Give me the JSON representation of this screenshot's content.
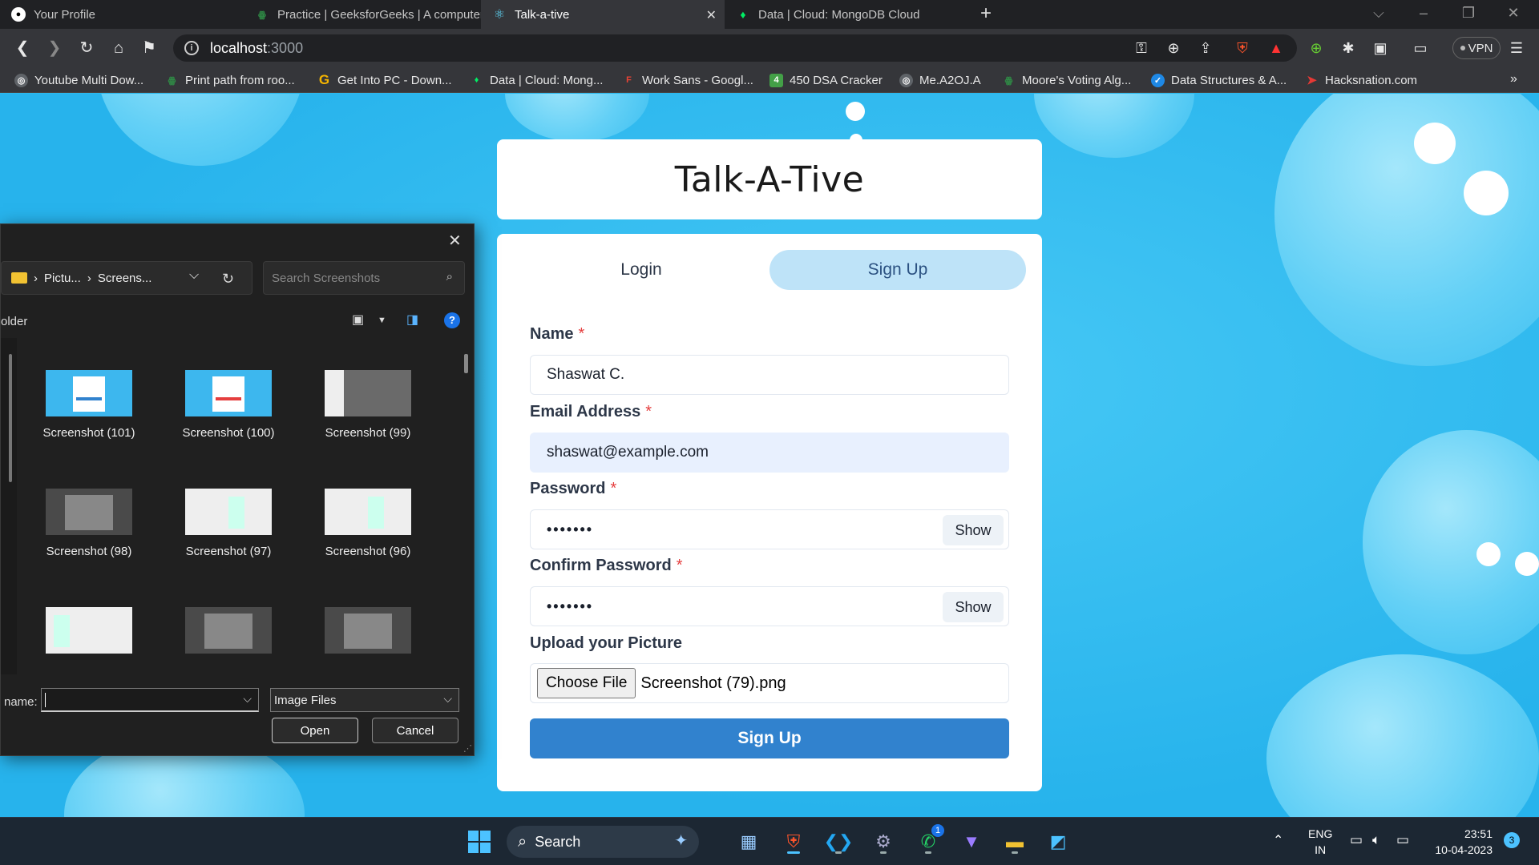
{
  "browser": {
    "tabs": [
      {
        "title": "Your Profile",
        "icon": "github-icon",
        "color": "#ffffff"
      },
      {
        "title": "Practice | GeeksforGeeks | A computer",
        "icon": "gfg-icon",
        "color": "#2f8d46"
      },
      {
        "title": "Talk-a-tive",
        "icon": "react-icon",
        "color": "#61dafb"
      },
      {
        "title": "Data | Cloud: MongoDB Cloud",
        "icon": "mongodb-icon",
        "color": "#00ed64"
      }
    ],
    "url": "localhost",
    "url_port": ":3000",
    "vpn_label": "VPN",
    "bookmarks": [
      {
        "label": "Youtube Multi Dow...",
        "icon": "globe-icon",
        "color": "#5f6368"
      },
      {
        "label": "Print path from roo...",
        "icon": "gfg-icon",
        "color": "#2f8d46"
      },
      {
        "label": "Get Into PC - Down...",
        "icon": "g-letter-icon",
        "color": "#f4b400"
      },
      {
        "label": "Data | Cloud: Mong...",
        "icon": "mongodb-icon",
        "color": "#00ed64"
      },
      {
        "label": "Work Sans - Googl...",
        "icon": "google-fonts-icon",
        "color": "#ea4335"
      },
      {
        "label": "450 DSA Cracker",
        "icon": "four-icon",
        "color": "#43a047"
      },
      {
        "label": "Me.A2OJ.A",
        "icon": "globe-icon",
        "color": "#5f6368"
      },
      {
        "label": "Moore's Voting Alg...",
        "icon": "gfg-icon",
        "color": "#2f8d46"
      },
      {
        "label": "Data Structures & A...",
        "icon": "check-icon",
        "color": "#1e88e5"
      },
      {
        "label": "Hacksnation.com",
        "icon": "arrow-icon",
        "color": "#e53935"
      }
    ]
  },
  "app": {
    "title": "Talk-A-Tive",
    "tabs": {
      "login": "Login",
      "signup": "Sign Up"
    },
    "form": {
      "name_label": "Name",
      "name_value": "Shaswat C.",
      "email_label": "Email Address",
      "email_value": "shaswat@example.com",
      "password_label": "Password",
      "password_mask": "•••••••",
      "confirm_label": "Confirm Password",
      "confirm_mask": "•••••••",
      "show_label": "Show",
      "required_mark": "*",
      "upload_label": "Upload your Picture",
      "choose_file_label": "Choose File",
      "file_name": "Screenshot (79).png",
      "submit_label": "Sign Up"
    }
  },
  "file_dialog": {
    "path": [
      "Pictu...",
      "Screens..."
    ],
    "search_placeholder": "Search Screenshots",
    "folder_label": "older",
    "thumbnails": [
      {
        "caption": "Screenshot (101)",
        "style": "blue"
      },
      {
        "caption": "Screenshot (100)",
        "style": "blue"
      },
      {
        "caption": "Screenshot (99)",
        "style": "gray"
      },
      {
        "caption": "Screenshot (98)",
        "style": "dark"
      },
      {
        "caption": "Screenshot (97)",
        "style": "white"
      },
      {
        "caption": "Screenshot (96)",
        "style": "white"
      },
      {
        "caption": "",
        "style": "white"
      },
      {
        "caption": "",
        "style": "dark"
      },
      {
        "caption": "",
        "style": "dark"
      }
    ],
    "name_label": "name:",
    "file_type": "Image Files",
    "open_label": "Open",
    "cancel_label": "Cancel"
  },
  "taskbar": {
    "search_label": "Search",
    "lang_line1": "ENG",
    "lang_line2": "IN",
    "time": "23:51",
    "date": "10-04-2023",
    "whatsapp_badge": "1",
    "notification_count": "3"
  }
}
